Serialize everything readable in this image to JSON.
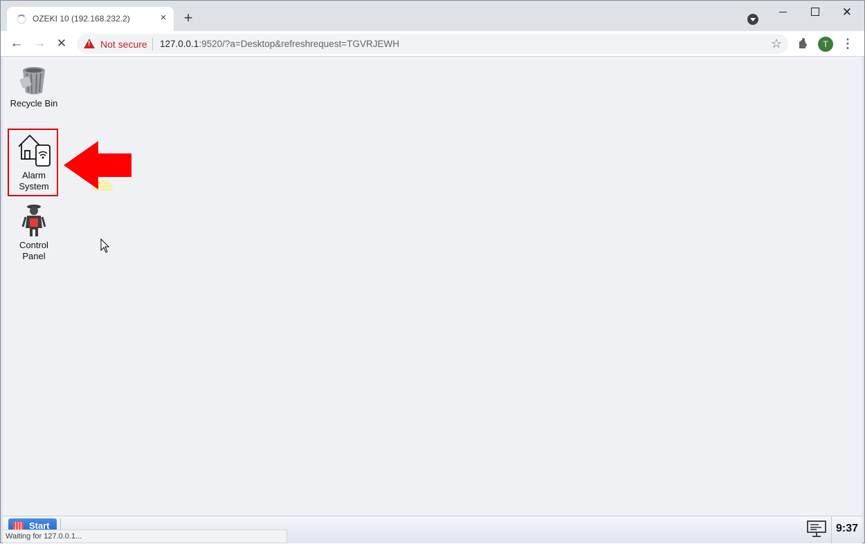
{
  "browser": {
    "tab_title": "OZEKI 10 (192.168.232.2)",
    "tab_close_icon": "×",
    "new_tab_icon": "+",
    "security_label": "Not secure",
    "url_host": "127.0.0.1",
    "url_rest": ":9520/?a=Desktop&refreshrequest=TGVRJEWH",
    "profile_initial": "T",
    "status_text": "Waiting for 127.0.0.1..."
  },
  "desktop": {
    "icons": [
      {
        "label": "Recycle Bin",
        "icon": "recycle-bin-icon"
      },
      {
        "label": "Alarm\nSystem",
        "icon": "alarm-system-icon"
      },
      {
        "label": "Control\nPanel",
        "icon": "control-panel-icon"
      }
    ],
    "annotation": {
      "type": "arrow",
      "color": "#ff0000",
      "target": "Alarm System"
    }
  },
  "taskbar": {
    "start_label": "Start",
    "clock": "9:37"
  },
  "colors": {
    "desktop_bg": "#eff1f5",
    "highlight": "#e00000",
    "warning": "#c5221f"
  }
}
